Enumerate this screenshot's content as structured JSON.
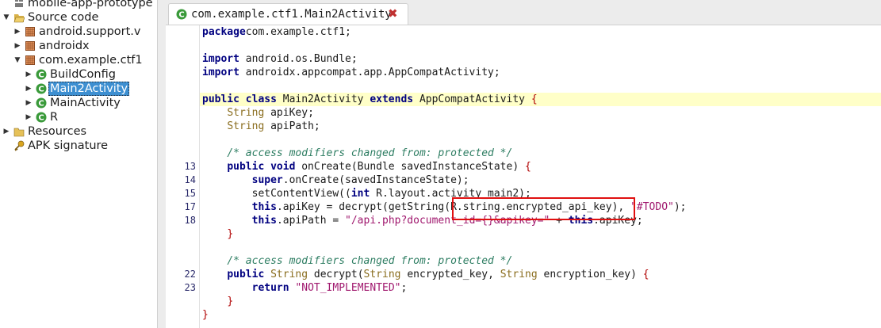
{
  "tree": {
    "items": [
      {
        "label": "mobile-app-prototype",
        "icon": "project-icon",
        "toggle": ""
      },
      {
        "label": "Source code",
        "icon": "folder-open-icon",
        "toggle": "▼"
      },
      {
        "label": "android.support.v",
        "icon": "package-icon",
        "toggle": "▶"
      },
      {
        "label": "androidx",
        "icon": "package-icon",
        "toggle": "▶"
      },
      {
        "label": "com.example.ctf1",
        "icon": "package-icon",
        "toggle": "▼"
      },
      {
        "label": "BuildConfig",
        "icon": "class-icon",
        "toggle": "▶"
      },
      {
        "label": "Main2Activity",
        "icon": "class-icon",
        "toggle": "▶"
      },
      {
        "label": "MainActivity",
        "icon": "class-icon",
        "toggle": "▶"
      },
      {
        "label": "R",
        "icon": "class-icon",
        "toggle": "▶"
      },
      {
        "label": "Resources",
        "icon": "folder-icon",
        "toggle": "▶"
      },
      {
        "label": "APK signature",
        "icon": "key-icon",
        "toggle": ""
      }
    ],
    "selected_index": 6
  },
  "tab": {
    "title": "com.example.ctf1.Main2Activity",
    "close": "✖"
  },
  "editor": {
    "lines": [
      {
        "ln": "",
        "tokens": [
          [
            "kw",
            "package"
          ],
          [
            "",
            "com.example.ctf1;"
          ]
        ]
      },
      {
        "ln": "",
        "tokens": []
      },
      {
        "ln": "",
        "tokens": [
          [
            "kw",
            "import"
          ],
          [
            "",
            " android.os.Bundle;"
          ]
        ]
      },
      {
        "ln": "",
        "tokens": [
          [
            "kw",
            "import"
          ],
          [
            "",
            " androidx.appcompat.app.AppCompatActivity;"
          ]
        ]
      },
      {
        "ln": "",
        "tokens": []
      },
      {
        "ln": "",
        "highlight": true,
        "tokens": [
          [
            "kw",
            "public class"
          ],
          [
            "",
            " Main2Activity "
          ],
          [
            "kw",
            "extends"
          ],
          [
            "",
            " AppCompatActivity "
          ],
          [
            "br",
            "{"
          ]
        ]
      },
      {
        "ln": "",
        "tokens": [
          [
            "",
            "    "
          ],
          [
            "ty",
            "String"
          ],
          [
            "",
            " apiKey;"
          ]
        ]
      },
      {
        "ln": "",
        "tokens": [
          [
            "",
            "    "
          ],
          [
            "ty",
            "String"
          ],
          [
            "",
            " apiPath;"
          ]
        ]
      },
      {
        "ln": "",
        "tokens": []
      },
      {
        "ln": "",
        "tokens": [
          [
            "",
            "    "
          ],
          [
            "com",
            "/* access modifiers changed from: protected */"
          ]
        ]
      },
      {
        "ln": "13",
        "tokens": [
          [
            "",
            "    "
          ],
          [
            "kw",
            "public void"
          ],
          [
            "",
            " onCreate(Bundle savedInstanceState) "
          ],
          [
            "br",
            "{"
          ]
        ]
      },
      {
        "ln": "14",
        "tokens": [
          [
            "",
            "        "
          ],
          [
            "kw",
            "super"
          ],
          [
            "",
            ".onCreate(savedInstanceState);"
          ]
        ]
      },
      {
        "ln": "15",
        "tokens": [
          [
            "",
            "        setContentView(("
          ],
          [
            "kw",
            "int"
          ],
          [
            "",
            " R.layout.activity_main2);"
          ]
        ]
      },
      {
        "ln": "17",
        "tokens": [
          [
            "",
            "        "
          ],
          [
            "kw",
            "this"
          ],
          [
            "",
            ".apiKey = decrypt(getString(R.string.encrypted_api_key), "
          ],
          [
            "str",
            "\"#TODO\""
          ],
          [
            "",
            ");"
          ]
        ]
      },
      {
        "ln": "18",
        "tokens": [
          [
            "",
            "        "
          ],
          [
            "kw",
            "this"
          ],
          [
            "",
            ".apiPath = "
          ],
          [
            "str",
            "\"/api.php?document_id={}&apikey=\""
          ],
          [
            "",
            " + "
          ],
          [
            "kw",
            "this"
          ],
          [
            "",
            ".apiKey;"
          ]
        ]
      },
      {
        "ln": "",
        "tokens": [
          [
            "",
            "    "
          ],
          [
            "br",
            "}"
          ]
        ]
      },
      {
        "ln": "",
        "tokens": []
      },
      {
        "ln": "",
        "tokens": [
          [
            "",
            "    "
          ],
          [
            "com",
            "/* access modifiers changed from: protected */"
          ]
        ]
      },
      {
        "ln": "22",
        "tokens": [
          [
            "",
            "    "
          ],
          [
            "kw",
            "public"
          ],
          [
            "",
            " "
          ],
          [
            "ty",
            "String"
          ],
          [
            "",
            " decrypt("
          ],
          [
            "ty",
            "String"
          ],
          [
            "",
            " encrypted_key, "
          ],
          [
            "ty",
            "String"
          ],
          [
            "",
            " encryption_key) "
          ],
          [
            "br",
            "{"
          ]
        ]
      },
      {
        "ln": "23",
        "tokens": [
          [
            "",
            "        "
          ],
          [
            "kw",
            "return"
          ],
          [
            "",
            " "
          ],
          [
            "str",
            "\"NOT_IMPLEMENTED\""
          ],
          [
            "",
            ";"
          ]
        ]
      },
      {
        "ln": "",
        "tokens": [
          [
            "",
            "    "
          ],
          [
            "br",
            "}"
          ]
        ]
      },
      {
        "ln": "",
        "tokens": [
          [
            "br",
            "}"
          ]
        ]
      }
    ]
  },
  "colors": {
    "selection": "#3d8fd1",
    "highlight_line": "#ffffc8",
    "annotation_box": "#e01010",
    "class_icon": "#3a9a3a",
    "package_icon": "#b86a3a"
  }
}
